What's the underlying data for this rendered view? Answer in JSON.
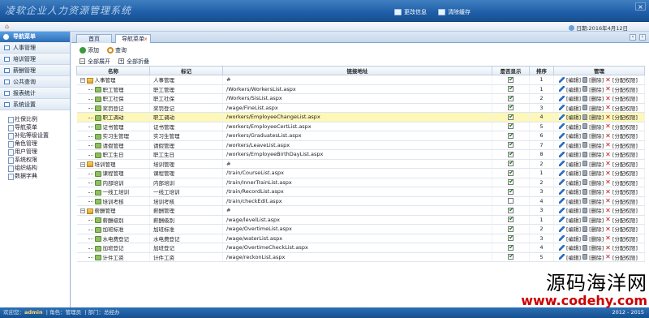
{
  "app": {
    "title": "凌软企业人力资源管理系统"
  },
  "topbar": {
    "account_label": "更改信息",
    "clear_label": "清除缓存",
    "close_label": "×"
  },
  "subbar": {
    "date": "日期:2016年4月12日"
  },
  "sidebar": {
    "header": "导航菜单",
    "items": [
      {
        "label": "人事管理"
      },
      {
        "label": "培训管理"
      },
      {
        "label": "薪酬管理"
      },
      {
        "label": "公共查询"
      },
      {
        "label": "报表统计"
      },
      {
        "label": "系统设置"
      }
    ],
    "sub_items": [
      {
        "label": "社保比例"
      },
      {
        "label": "导航菜单"
      },
      {
        "label": "补贴等级设置"
      },
      {
        "label": "角色管理"
      },
      {
        "label": "用户管理"
      },
      {
        "label": "系统权限"
      },
      {
        "label": "组织结构"
      },
      {
        "label": "数据字典"
      }
    ]
  },
  "tabs": [
    {
      "label": "首页"
    },
    {
      "label": "导航菜单"
    }
  ],
  "toolbar": {
    "add_label": "添加",
    "search_label": "查询",
    "expand_label": "全部展开",
    "collapse_label": "全部折叠"
  },
  "table": {
    "headers": [
      "名称",
      "标记",
      "链接地址",
      "是否显示",
      "排序",
      "管理"
    ],
    "action_edit": "[编辑]",
    "action_delete": "[删除]",
    "action_assign": "[分配权限]",
    "rows": [
      {
        "name": "人事管理",
        "mark": "人事管理",
        "url": "#",
        "show": true,
        "order": "1",
        "level": 0,
        "highlight": false
      },
      {
        "name": "职工管理",
        "mark": "职工管理",
        "url": "/Workers/WorkersList.aspx",
        "show": true,
        "order": "1",
        "level": 1,
        "highlight": false
      },
      {
        "name": "职工社保",
        "mark": "职工社保",
        "url": "/Workers/SisList.aspx",
        "show": true,
        "order": "2",
        "level": 1,
        "highlight": false
      },
      {
        "name": "奖罚登记",
        "mark": "奖罚登记",
        "url": "/wage/FineList.aspx",
        "show": true,
        "order": "3",
        "level": 1,
        "highlight": false
      },
      {
        "name": "职工调动",
        "mark": "职工调动",
        "url": "/workers/EmployeeChangeList.aspx",
        "show": true,
        "order": "4",
        "level": 1,
        "highlight": true
      },
      {
        "name": "证书管理",
        "mark": "证书管理",
        "url": "/workers/EmployeeCertList.aspx",
        "show": true,
        "order": "5",
        "level": 1,
        "highlight": false
      },
      {
        "name": "实习生管理",
        "mark": "实习生管理",
        "url": "/workers/GraduatesList.aspx",
        "show": true,
        "order": "6",
        "level": 1,
        "highlight": false
      },
      {
        "name": "请假管理",
        "mark": "请假管理",
        "url": "/workers/LeaveList.aspx",
        "show": true,
        "order": "7",
        "level": 1,
        "highlight": false
      },
      {
        "name": "职工生日",
        "mark": "职工生日",
        "url": "/workers/EmployeeBirthDayList.aspx",
        "show": true,
        "order": "8",
        "level": 1,
        "highlight": false
      },
      {
        "name": "培训管理",
        "mark": "培训管理",
        "url": "#",
        "show": true,
        "order": "2",
        "level": 0,
        "highlight": false
      },
      {
        "name": "课程管理",
        "mark": "课程管理",
        "url": "/train/CourseList.aspx",
        "show": true,
        "order": "1",
        "level": 1,
        "highlight": false
      },
      {
        "name": "内部培训",
        "mark": "内部培训",
        "url": "/train/InnerTrainList.aspx",
        "show": true,
        "order": "2",
        "level": 1,
        "highlight": false
      },
      {
        "name": "一线工培训",
        "mark": "一线工培训",
        "url": "/train/RecordList.aspx",
        "show": true,
        "order": "3",
        "level": 1,
        "highlight": false
      },
      {
        "name": "培训考核",
        "mark": "培训考核",
        "url": "/train/checkEdit.aspx",
        "show": false,
        "order": "4",
        "level": 1,
        "highlight": false
      },
      {
        "name": "薪酬管理",
        "mark": "薪酬管理",
        "url": "#",
        "show": true,
        "order": "3",
        "level": 0,
        "highlight": false
      },
      {
        "name": "薪酬级别",
        "mark": "薪酬级别",
        "url": "/wage/levelList.aspx",
        "show": true,
        "order": "1",
        "level": 1,
        "highlight": false
      },
      {
        "name": "加班标准",
        "mark": "加班标准",
        "url": "/wage/OvertimeList.aspx",
        "show": true,
        "order": "2",
        "level": 1,
        "highlight": false
      },
      {
        "name": "水电费登记",
        "mark": "水电费登记",
        "url": "/wage/waterList.aspx",
        "show": true,
        "order": "3",
        "level": 1,
        "highlight": false
      },
      {
        "name": "加班登记",
        "mark": "加班登记",
        "url": "/wage/OvertimeCheckList.aspx",
        "show": true,
        "order": "4",
        "level": 1,
        "highlight": false
      },
      {
        "name": "计件工资",
        "mark": "计件工资",
        "url": "/wage/reckonList.aspx",
        "show": true,
        "order": "5",
        "level": 1,
        "highlight": false
      }
    ]
  },
  "statusbar": {
    "user_label": "欢迎您：",
    "user": "admin",
    "role_label": "角色：",
    "role": "管理员",
    "dept_label": "部门：",
    "dept": "总经办",
    "version": "2012 - 2015"
  },
  "watermark": {
    "cn": "源码海洋网",
    "url": "www.codehy.com"
  }
}
